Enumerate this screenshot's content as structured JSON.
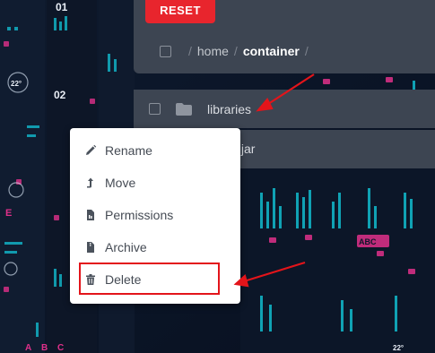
{
  "toolbar": {
    "reset_label": "RESET"
  },
  "breadcrumb": {
    "separator": "/",
    "items": [
      "home",
      "container"
    ]
  },
  "rows": [
    {
      "name": "libraries",
      "icon": "folder-icon"
    },
    {
      "name": ".jar"
    }
  ],
  "context_menu": {
    "items": [
      {
        "label": "Rename",
        "icon": "pencil-icon"
      },
      {
        "label": "Move",
        "icon": "arrow-up-icon"
      },
      {
        "label": "Permissions",
        "icon": "file-permissions-icon"
      },
      {
        "label": "Archive",
        "icon": "file-archive-icon"
      },
      {
        "label": "Delete",
        "icon": "trash-icon"
      }
    ]
  },
  "background": {
    "rack_labels": [
      "01",
      "02",
      "22°",
      "E",
      "ABC",
      "A",
      "B",
      "C",
      "22°"
    ]
  },
  "colors": {
    "accent": "#e8252d",
    "panel": "#3d4552",
    "highlight": "#e3141a",
    "menu_text": "#454b54"
  }
}
